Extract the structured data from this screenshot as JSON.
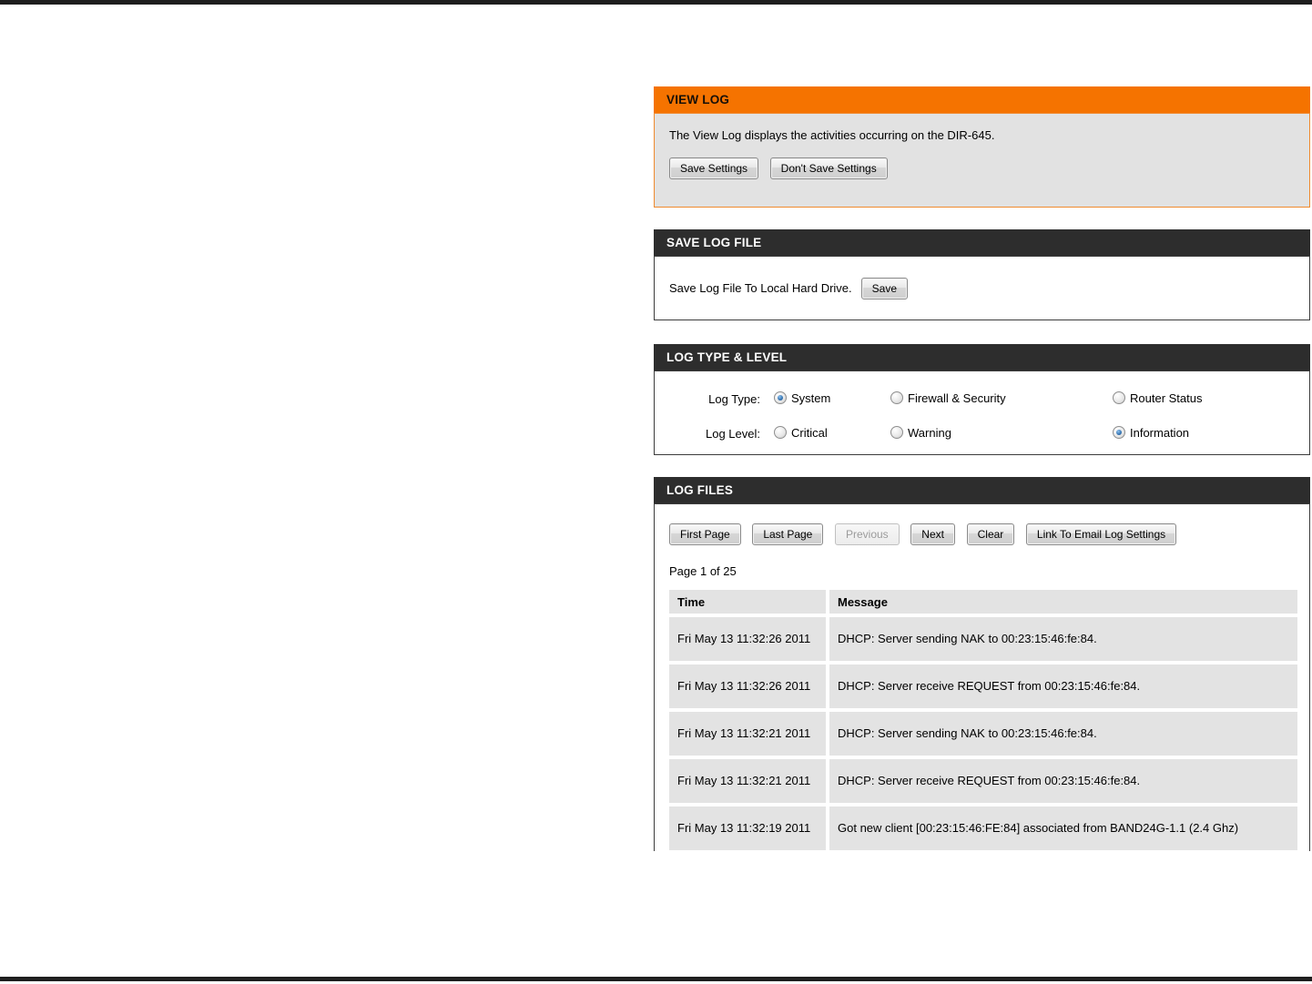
{
  "colors": {
    "accent_orange": "#f57300",
    "header_dark": "#2d2d2d",
    "panel_gray": "#e2e2e2",
    "table_cell_gray": "#e3e3e3"
  },
  "view_log": {
    "title": "VIEW LOG",
    "description": "The View Log displays the activities occurring on the DIR-645.",
    "save_settings_label": "Save Settings",
    "dont_save_settings_label": "Don't Save Settings"
  },
  "save_log_file": {
    "title": "SAVE LOG FILE",
    "label": "Save Log File To Local Hard Drive.",
    "save_label": "Save"
  },
  "log_type_level": {
    "title": "LOG TYPE & LEVEL",
    "rows": [
      {
        "label": "Log Type:",
        "options": [
          {
            "label": "System",
            "checked": true
          },
          {
            "label": "Firewall & Security",
            "checked": false
          },
          {
            "label": "Router Status",
            "checked": false
          }
        ]
      },
      {
        "label": "Log Level:",
        "options": [
          {
            "label": "Critical",
            "checked": false
          },
          {
            "label": "Warning",
            "checked": false
          },
          {
            "label": "Information",
            "checked": true
          }
        ]
      }
    ]
  },
  "log_files": {
    "title": "LOG FILES",
    "buttons": [
      {
        "label": "First Page",
        "disabled": false
      },
      {
        "label": "Last Page",
        "disabled": false
      },
      {
        "label": "Previous",
        "disabled": true
      },
      {
        "label": "Next",
        "disabled": false
      },
      {
        "label": "Clear",
        "disabled": false
      },
      {
        "label": "Link To Email Log Settings",
        "disabled": false
      }
    ],
    "page_indicator": "Page 1 of 25",
    "table": {
      "headers": [
        "Time",
        "Message"
      ],
      "rows": [
        {
          "time": "Fri May 13 11:32:26 2011",
          "message": "DHCP: Server sending NAK to 00:23:15:46:fe:84."
        },
        {
          "time": "Fri May 13 11:32:26 2011",
          "message": "DHCP: Server receive REQUEST from 00:23:15:46:fe:84."
        },
        {
          "time": "Fri May 13 11:32:21 2011",
          "message": "DHCP: Server sending NAK to 00:23:15:46:fe:84."
        },
        {
          "time": "Fri May 13 11:32:21 2011",
          "message": "DHCP: Server receive REQUEST from 00:23:15:46:fe:84."
        },
        {
          "time": "Fri May 13 11:32:19 2011",
          "message": "Got new client [00:23:15:46:FE:84] associated from BAND24G-1.1 (2.4 Ghz)"
        }
      ]
    }
  }
}
